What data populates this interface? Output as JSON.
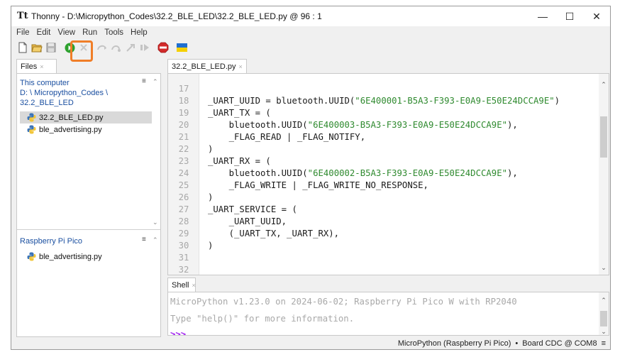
{
  "window": {
    "title": "Thonny  -  D:\\Micropython_Codes\\32.2_BLE_LED\\32.2_BLE_LED.py  @  96 : 1",
    "minimize": "—",
    "maximize": "☐",
    "close": "✕"
  },
  "menu": [
    "File",
    "Edit",
    "View",
    "Run",
    "Tools",
    "Help"
  ],
  "toolbar": {
    "icons": [
      "new-file-icon",
      "open-file-icon",
      "save-icon",
      "run-icon",
      "debug-icon",
      "step-over-icon",
      "step-into-icon",
      "step-out-icon",
      "resume-icon",
      "stop-icon",
      "ukraine-flag-icon"
    ],
    "highlight_color": "#f07e28"
  },
  "files": {
    "tab_label": "Files",
    "tab_close": "×",
    "menu_glyph": "≡",
    "this_computer": {
      "title": "This computer",
      "path_line1": "D: \\ Micropython_Codes \\",
      "path_line2": "32.2_BLE_LED",
      "items": [
        {
          "name": "32.2_BLE_LED.py",
          "selected": true
        },
        {
          "name": "ble_advertising.py",
          "selected": false
        }
      ]
    },
    "device": {
      "title": "Raspberry Pi Pico",
      "items": [
        {
          "name": "ble_advertising.py",
          "selected": false
        }
      ]
    }
  },
  "editor": {
    "tab_label": "32.2_BLE_LED.py",
    "tab_close": "×",
    "lines": [
      {
        "n": "17",
        "pre": "",
        "str": "",
        "post": ""
      },
      {
        "n": "18",
        "pre": "_UART_UUID = bluetooth.UUID(",
        "str": "\"6E400001-B5A3-F393-E0A9-E50E24DCCA9E\"",
        "post": ")"
      },
      {
        "n": "19",
        "pre": "_UART_TX = (",
        "str": "",
        "post": ""
      },
      {
        "n": "20",
        "pre": "    bluetooth.UUID(",
        "str": "\"6E400003-B5A3-F393-E0A9-E50E24DCCA9E\"",
        "post": "),"
      },
      {
        "n": "21",
        "pre": "    _FLAG_READ | _FLAG_NOTIFY,",
        "str": "",
        "post": ""
      },
      {
        "n": "22",
        "pre": ")",
        "str": "",
        "post": ""
      },
      {
        "n": "23",
        "pre": "_UART_RX = (",
        "str": "",
        "post": ""
      },
      {
        "n": "24",
        "pre": "    bluetooth.UUID(",
        "str": "\"6E400002-B5A3-F393-E0A9-E50E24DCCA9E\"",
        "post": "),"
      },
      {
        "n": "25",
        "pre": "    _FLAG_WRITE | _FLAG_WRITE_NO_RESPONSE,",
        "str": "",
        "post": ""
      },
      {
        "n": "26",
        "pre": ")",
        "str": "",
        "post": ""
      },
      {
        "n": "27",
        "pre": "_UART_SERVICE = (",
        "str": "",
        "post": ""
      },
      {
        "n": "28",
        "pre": "    _UART_UUID,",
        "str": "",
        "post": ""
      },
      {
        "n": "29",
        "pre": "    (_UART_TX, _UART_RX),",
        "str": "",
        "post": ""
      },
      {
        "n": "30",
        "pre": ")",
        "str": "",
        "post": ""
      },
      {
        "n": "31",
        "pre": "",
        "str": "",
        "post": ""
      },
      {
        "n": "32",
        "pre": "",
        "str": "",
        "post": ""
      }
    ]
  },
  "shell": {
    "tab_label": "Shell",
    "tab_close": "×",
    "banner": "MicroPython v1.23.0 on 2024-06-02; Raspberry Pi Pico W with RP2040",
    "help_hint": "Type \"help()\" for more information.",
    "prompt": ">>>"
  },
  "status": {
    "interpreter": "MicroPython (Raspberry Pi Pico)",
    "separator": "•",
    "port": "Board CDC @ COM8",
    "menu_glyph": "≡"
  }
}
